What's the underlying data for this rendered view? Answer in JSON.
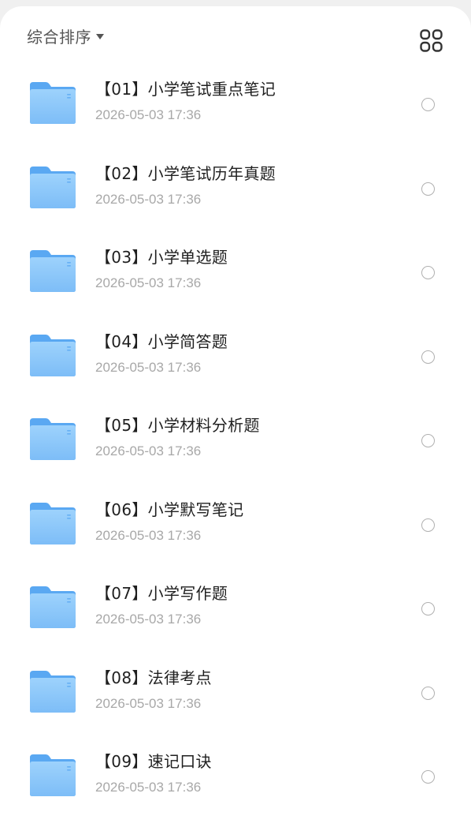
{
  "toolbar": {
    "sort_label": "综合排序",
    "sort_icon": "caret-down-icon",
    "view_icon": "grid-view-icon"
  },
  "files": [
    {
      "name": "【01】小学笔试重点笔记",
      "date": "2026-05-03 17:36"
    },
    {
      "name": "【02】小学笔试历年真题",
      "date": "2026-05-03 17:36"
    },
    {
      "name": "【03】小学单选题",
      "date": "2026-05-03 17:36"
    },
    {
      "name": "【04】小学简答题",
      "date": "2026-05-03 17:36"
    },
    {
      "name": "【05】小学材料分析题",
      "date": "2026-05-03 17:36"
    },
    {
      "name": "【06】小学默写笔记",
      "date": "2026-05-03 17:36"
    },
    {
      "name": "【07】小学写作题",
      "date": "2026-05-03 17:36"
    },
    {
      "name": "【08】法律考点",
      "date": "2026-05-03 17:36"
    },
    {
      "name": "【09】速记口诀",
      "date": "2026-05-03 17:36"
    }
  ],
  "colors": {
    "folder_back": "#5aa8f2",
    "folder_front": "#8cc9fb",
    "title_text": "#1f1f1f",
    "date_text": "#a8a8a8"
  }
}
